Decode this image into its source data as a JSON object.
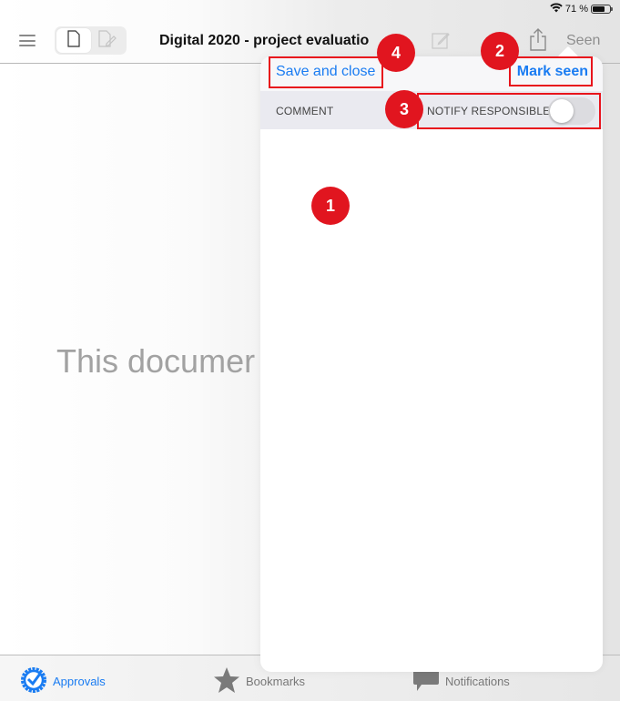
{
  "status_bar": {
    "battery_text": "71 %",
    "battery_level": 0.71,
    "wifi_icon": "wifi-icon"
  },
  "nav_bar": {
    "menu_icon": "hamburger-menu-icon",
    "view_segments": [
      {
        "name": "document-view",
        "icon": "document-icon",
        "active": true
      },
      {
        "name": "annotate-view",
        "icon": "document-edit-icon",
        "active": false
      }
    ],
    "title": "Digital 2020 - project evaluatio",
    "edit_icon": "edit-icon",
    "share_icon": "share-icon",
    "seen_label": "Seen"
  },
  "document": {
    "placeholder_text": "This documer"
  },
  "popover": {
    "save_and_close_label": "Save and close",
    "mark_seen_label": "Mark seen",
    "comment_label": "COMMENT",
    "notify_responsible_label": "NOTIFY RESPONSIBLE",
    "notify_responsible_on": false,
    "comment_value": ""
  },
  "annotations": [
    {
      "number": "1",
      "target": "comment-area"
    },
    {
      "number": "2",
      "target": "mark-seen-button"
    },
    {
      "number": "3",
      "target": "notify-responsible-toggle"
    },
    {
      "number": "4",
      "target": "save-and-close-button"
    }
  ],
  "annotation_color": "#e1151f",
  "accent_color": "#1a7cf2",
  "tab_bar": {
    "tabs": [
      {
        "label": "Approvals",
        "icon": "approval-badge-icon",
        "active": true
      },
      {
        "label": "Bookmarks",
        "icon": "star-icon",
        "active": false
      },
      {
        "label": "Notifications",
        "icon": "chat-bubble-icon",
        "active": false
      }
    ]
  }
}
